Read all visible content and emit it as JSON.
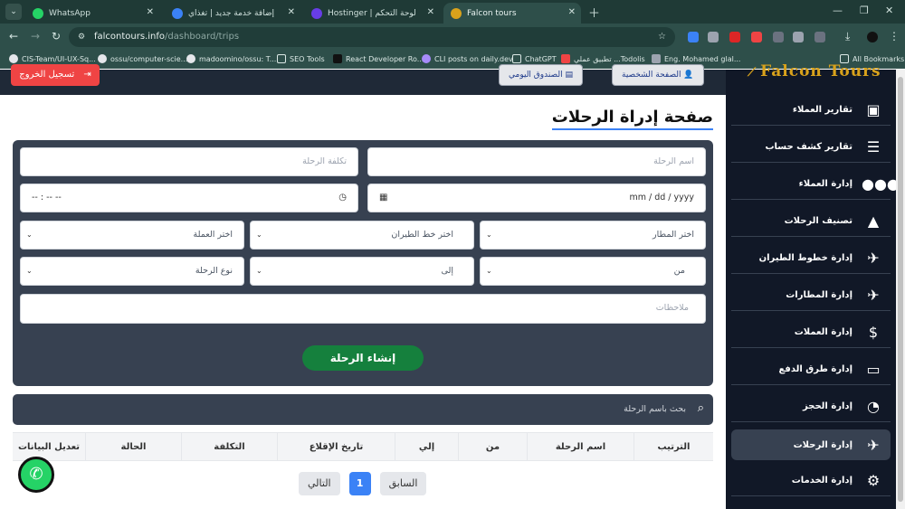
{
  "browser": {
    "tabs": [
      {
        "title": "WhatsApp",
        "favicon": "whatsapp-icon",
        "color": "#25d366"
      },
      {
        "title": "إضافة خدمة جديد | تغذاي",
        "favicon": "site-icon",
        "color": "#3b82f6"
      },
      {
        "title": "Hostinger | لوحة التحكم",
        "favicon": "hostinger-icon",
        "color": "#673de6"
      },
      {
        "title": "Falcon tours",
        "favicon": "falcon-icon",
        "color": "#d9a21b",
        "active": true
      }
    ],
    "url_host": "falcontours.info",
    "url_path": "/dashboard/trips",
    "bookmarks": [
      "CIS-Team/UI-UX-Sq...",
      "ossu/computer-scie...",
      "madoomino/ossu: T...",
      "SEO Tools",
      "React Developer Ro...",
      "CLI posts on daily.dev",
      "ChatGPT",
      "تطبيق عملي ...Todolis",
      "Eng. Mohamed glal...",
      "All Bookmarks"
    ]
  },
  "header": {
    "logout_label": "تسجيل الخروج",
    "btn_profile": "الصفحة الشخصية",
    "btn_box": "الصندوق اليومي"
  },
  "logo": "Falcon Tours",
  "sidebar": {
    "items": [
      {
        "label": "تقارير العملاء",
        "icon": "id-card-icon",
        "glyph": "🪪"
      },
      {
        "label": "تقارير كشف حساب",
        "icon": "document-icon",
        "glyph": "📰"
      },
      {
        "label": "إدارة العملاء",
        "icon": "users-icon",
        "glyph": "👥"
      },
      {
        "label": "تصنيف الرحلات",
        "icon": "shapes-icon",
        "glyph": "▲"
      },
      {
        "label": "إدارة خطوط الطيران",
        "icon": "route-icon",
        "glyph": "✈"
      },
      {
        "label": "إدارة المطارات",
        "icon": "plane-departure-icon",
        "glyph": "🛫"
      },
      {
        "label": "إدارة العملات",
        "icon": "dollar-icon",
        "glyph": "＄"
      },
      {
        "label": "إدارة طرق الدفع",
        "icon": "credit-card-icon",
        "glyph": "▬"
      },
      {
        "label": "إدارة الحجز",
        "icon": "gauge-icon",
        "glyph": "◔"
      },
      {
        "label": "إدارة الرحلات",
        "icon": "plane-icon",
        "glyph": "✈",
        "active": true
      },
      {
        "label": "إدارة الخدمات",
        "icon": "gears-icon",
        "glyph": "⚙"
      }
    ]
  },
  "main": {
    "title": "صفحة إدراة الرحلات",
    "form": {
      "trip_name_placeholder": "اسم الرحلة",
      "trip_cost_placeholder": "تكلفة الرحلة",
      "date_placeholder": "mm / dd / yyyy",
      "time_placeholder": "-- : -- --",
      "airport_select": "اختر المطار",
      "airline_select": "اختر خط الطيران",
      "currency_select": "اختر العملة",
      "from_select": "من",
      "to_select": "إلى",
      "trip_type_select": "نوع الرحلة",
      "notes_placeholder": "ملاحظات",
      "submit_label": "إنشاء الرحلة"
    },
    "search_placeholder": "بحث باسم الرحلة",
    "table_headers": [
      "الترتيب",
      "اسم الرحلة",
      "من",
      "إلي",
      "تاريخ الإقلاع",
      "التكلفة",
      "الحالة",
      "تعديل البيانات"
    ],
    "pagination": {
      "prev": "السابق",
      "page": "1",
      "next": "التالي"
    }
  }
}
